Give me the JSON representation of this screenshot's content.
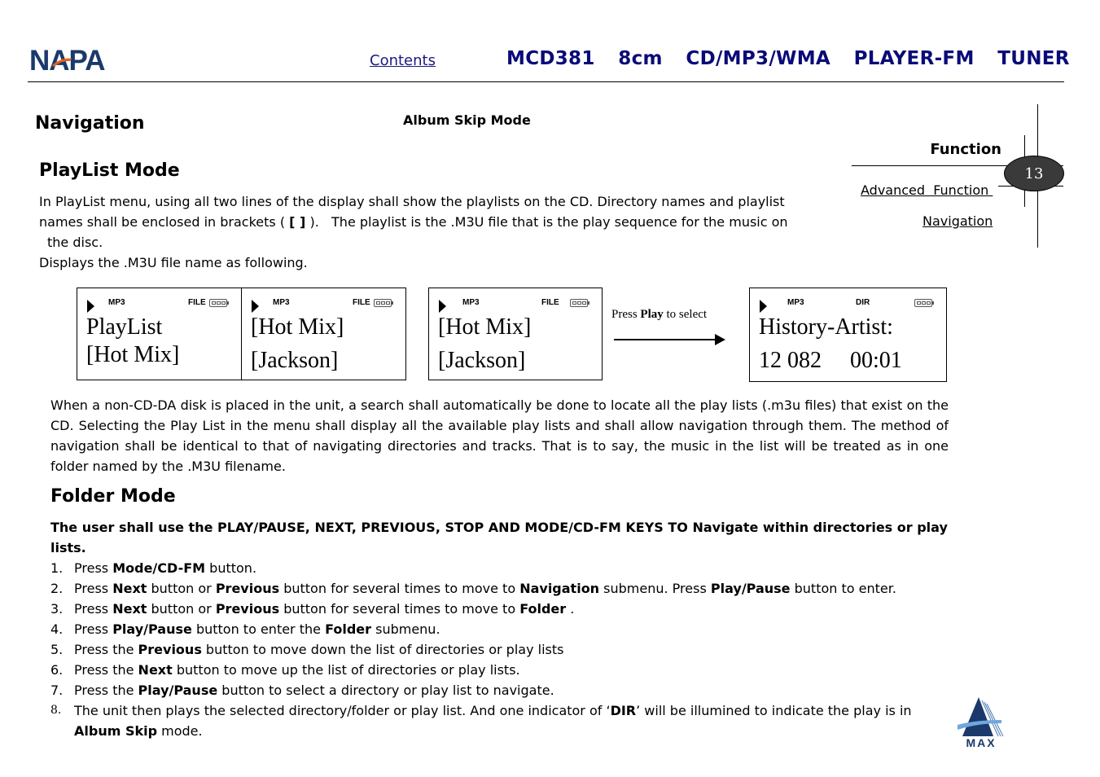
{
  "header": {
    "brand_logo": "NAPA",
    "contents_link": "Contents",
    "title": "MCD381  8cm  CD/MP3/WMA  PLAYER-FM  TUNER"
  },
  "side_nav": {
    "section": "Function",
    "page_number": "13",
    "links": [
      "Advanced  Function ",
      "Navigation"
    ]
  },
  "headings": {
    "navigation": "Navigation",
    "album_skip_mode": "Album Skip Mode",
    "playlist_mode": "PlayList Mode",
    "folder_mode": "Folder Mode"
  },
  "intro": {
    "line1": "In PlayList menu, using all two lines of the display shall show the playlists on the CD. Directory names and playlist",
    "line2a": "names shall be enclosed in brackets ( ",
    "line2_bold": "[ ]",
    "line2b": " ).   The playlist is the .M3U file that is the play sequence for the music on",
    "line3": "the disc.",
    "line4": "Displays the .M3U file name as following."
  },
  "displays": [
    {
      "format": "MP3",
      "mode": "FILE",
      "line1": "PlayList",
      "line2": "[Hot Mix]"
    },
    {
      "format": "MP3",
      "mode": "FILE",
      "line1": "[Hot Mix]",
      "line2": "[Jackson]"
    },
    {
      "format": "MP3",
      "mode": "FILE",
      "line1": "[Hot Mix]",
      "line2": "[Jackson]"
    },
    {
      "format": "MP3",
      "mode": "DIR",
      "line1": "History-Artist:",
      "line2": "12 082     00:01"
    }
  ],
  "transition": {
    "pre": "Press ",
    "bold": "Play",
    "post": " to select"
  },
  "search_paragraph": "When a non-CD-DA disk is placed in the unit, a search shall automatically be done to locate all the play lists (.m3u files) that exist on the CD.   Selecting the Play List in the menu shall display all the available play lists and shall allow navigation through them. The method of navigation shall be identical to that of navigating directories and tracks. That is to say, the music in the list will be treated as in one folder named by the .M3U filename.",
  "folder_intro": "The user shall use the PLAY/PAUSE, NEXT, PREVIOUS, STOP AND MODE/CD-FM KEYS TO Navigate within directories or play lists.",
  "steps": [
    {
      "num": "1.",
      "parts": [
        [
          "Press ",
          false
        ],
        [
          "Mode/CD-FM",
          true
        ],
        [
          " button.",
          false
        ]
      ]
    },
    {
      "num": "2.",
      "parts": [
        [
          "Press ",
          false
        ],
        [
          "Next",
          true
        ],
        [
          " button or ",
          false
        ],
        [
          "Previous",
          true
        ],
        [
          " button for several times to move to ",
          false
        ],
        [
          "Navigation",
          true
        ],
        [
          " submenu. Press ",
          false
        ],
        [
          "Play/Pause",
          true
        ],
        [
          " button to enter.",
          false
        ]
      ]
    },
    {
      "num": "3.",
      "parts": [
        [
          "Press ",
          false
        ],
        [
          "Next",
          true
        ],
        [
          " button or ",
          false
        ],
        [
          "Previous",
          true
        ],
        [
          " button for several times to move to ",
          false
        ],
        [
          "Folder",
          true
        ],
        [
          " .",
          false
        ]
      ]
    },
    {
      "num": "4.",
      "parts": [
        [
          "Press ",
          false
        ],
        [
          "Play/Pause",
          true
        ],
        [
          " button to enter the ",
          false
        ],
        [
          "Folder",
          true
        ],
        [
          " submenu.",
          false
        ]
      ]
    },
    {
      "num": "5.",
      "parts": [
        [
          "Press the ",
          false
        ],
        [
          "Previous",
          true
        ],
        [
          " button to move down the list of directories or play lists",
          false
        ]
      ]
    },
    {
      "num": "6.",
      "parts": [
        [
          "Press the ",
          false
        ],
        [
          "Next",
          true
        ],
        [
          " button to move up the list of directories or play lists.",
          false
        ]
      ]
    },
    {
      "num": "7.",
      "parts": [
        [
          "Press the ",
          false
        ],
        [
          "Play/Pause",
          true
        ],
        [
          " button to select a directory or play list to navigate.",
          false
        ]
      ]
    },
    {
      "num": "8.",
      "parts": [
        [
          "The unit then plays the selected directory/folder or play list. And one indicator of ‘",
          false
        ],
        [
          "DIR",
          true
        ],
        [
          "’ will be illumined to indicate the play is in ",
          false
        ],
        [
          "Album Skip",
          true
        ],
        [
          " mode.",
          false
        ]
      ]
    }
  ],
  "footer": {
    "logo": "MAX"
  },
  "colors": {
    "title_navy": "#0a0a78",
    "link_blue": "#1a1a80",
    "logo_navy": "#1b3a6b",
    "logo_orange": "#e8601c",
    "badge_fill": "#3a3a3a"
  }
}
